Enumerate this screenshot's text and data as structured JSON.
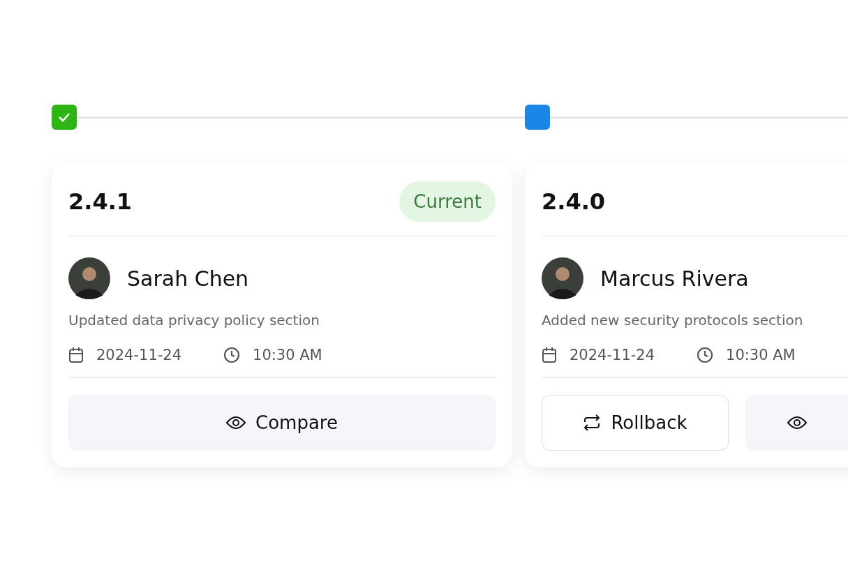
{
  "timeline": {
    "nodes": [
      {
        "completed": true
      },
      {
        "completed": false
      }
    ]
  },
  "versions": [
    {
      "version": "2.4.1",
      "badge": "Current",
      "author": "Sarah Chen",
      "description": "Updated data privacy policy section",
      "date": "2024-11-24",
      "time": "10:30 AM",
      "actions": [
        {
          "kind": "compare",
          "label": "Compare"
        }
      ]
    },
    {
      "version": "2.4.0",
      "author": "Marcus Rivera",
      "description": "Added new security protocols section",
      "date": "2024-11-24",
      "time": "10:30 AM",
      "actions": [
        {
          "kind": "rollback",
          "label": "Rollback"
        },
        {
          "kind": "compare"
        }
      ]
    }
  ]
}
